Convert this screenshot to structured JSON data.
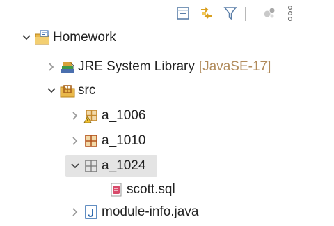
{
  "colors": {
    "text": "#222222",
    "decoration": "#b08a5a",
    "selection": "#e4e4e4",
    "package": "#c58a2f",
    "sql": "#d84a6a",
    "java": "#1f5fa8"
  },
  "toolbar": {
    "icons": [
      "collapse-all-icon",
      "link-with-editor-icon",
      "filter-icon",
      "focus-icon",
      "view-menu-icon"
    ]
  },
  "tree": {
    "project": {
      "label": "Homework",
      "expanded": true,
      "children": {
        "jre": {
          "label": "JRE System Library",
          "decoration": "[JavaSE-17]",
          "expanded": false
        },
        "src": {
          "label": "src",
          "expanded": true,
          "packages": [
            {
              "label": "a_1006",
              "expanded": false,
              "state": "has-warnings"
            },
            {
              "label": "a_1010",
              "expanded": false,
              "state": "normal"
            },
            {
              "label": "a_1024",
              "expanded": true,
              "state": "selected",
              "files": [
                {
                  "label": "scott.sql"
                }
              ]
            }
          ],
          "module_info": {
            "label": "module-info.java",
            "expanded": false
          }
        }
      }
    }
  }
}
